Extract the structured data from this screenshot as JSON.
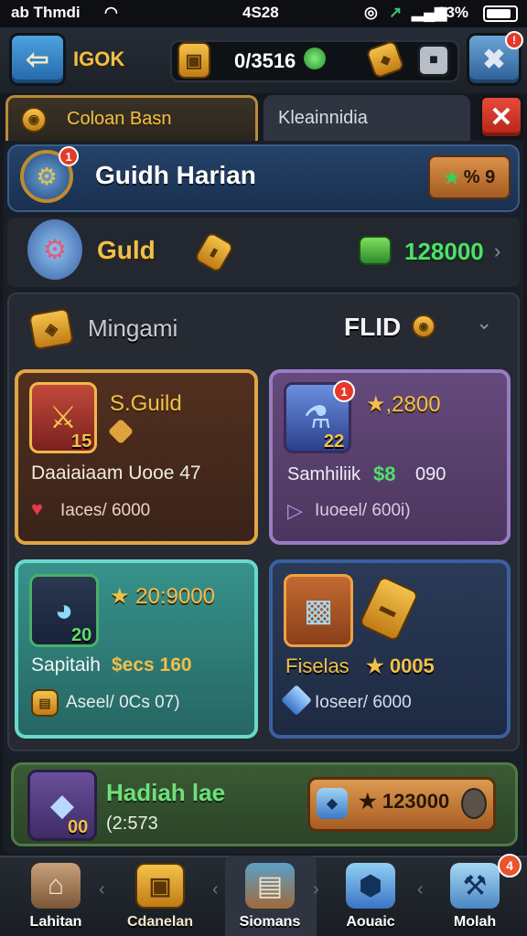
{
  "status_bar": {
    "carrier": "ab Thmdi",
    "time": "4S28",
    "battery": "93%"
  },
  "top_bar": {
    "currency_value": "0/3516"
  },
  "tabs": [
    {
      "label": "Coloan Basn",
      "active": true
    },
    {
      "label": "Kleainnidia",
      "active": false
    }
  ],
  "header": {
    "title": "Guidh Harian",
    "badge": "1",
    "button_label": "% 9"
  },
  "guild_row": {
    "label": "Guld",
    "value": "128000"
  },
  "section": {
    "title": "Mingami",
    "right_label": "FLID"
  },
  "cards": [
    {
      "title": "S.Guild",
      "level": "15",
      "line1": "Daaiaiaam Uooe 47",
      "line2": "Iaces/ 6000"
    },
    {
      "title": "★,2800",
      "badge": "1",
      "level": "22",
      "line1": "Samhiliik",
      "line1_value": "$8",
      "line1_value2": "090",
      "line2": "Iuoeel/ 600i)"
    },
    {
      "title": "★ 20:9000",
      "level": "20",
      "line1": "Sapitaih",
      "line1_value": "$ecs 160",
      "line2": "Aseel/ 0Cs 07)"
    },
    {
      "title": "",
      "level": "",
      "line1": "Fiselas",
      "line1_value": "★ 0005",
      "line2": "Ioseer/ 6000"
    }
  ],
  "reward": {
    "title": "Hadiah lae",
    "subtitle": "(2:573",
    "level": "00",
    "button_value": "★ 123000"
  },
  "nav": [
    {
      "label": "Lahitan"
    },
    {
      "label": "Cdanelan"
    },
    {
      "label": "Siomans"
    },
    {
      "label": "Aouaic"
    },
    {
      "label": "Molah",
      "badge": "4"
    }
  ],
  "colors": {
    "gold_card": "#4a2c20",
    "purple_card": "#5a3f6e",
    "teal_card": "#2f7c78",
    "blue_card": "#26344e",
    "green_accent": "#4ee06a",
    "header_blue": "#1d3556"
  }
}
